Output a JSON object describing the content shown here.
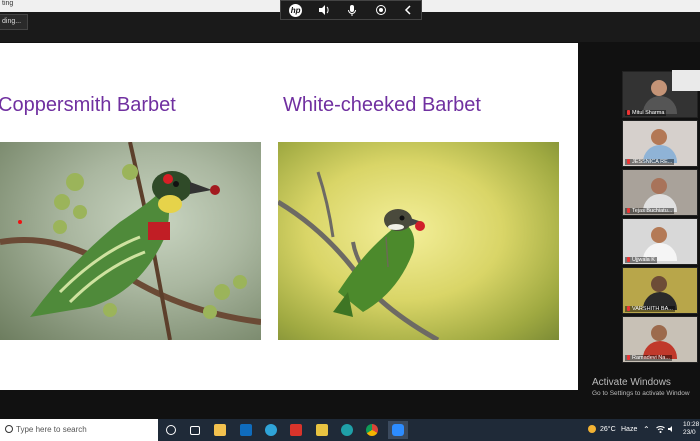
{
  "window": {
    "title_fragment": "ting",
    "recording_label": "ding..."
  },
  "slide": {
    "left_title": "Coppersmith Barbet",
    "right_title": "White-cheeked Barbet"
  },
  "participants": [
    {
      "name": "Mitul Sharma"
    },
    {
      "name": "JESSNICA RE..."
    },
    {
      "name": "Tejas Buchiatu..."
    },
    {
      "name": "Ujjwala K"
    },
    {
      "name": "VARSHITH BA..."
    },
    {
      "name": "Ramadevi Na..."
    }
  ],
  "watermark": {
    "line1": "Activate Windows",
    "line2": "Go to Settings to activate Window"
  },
  "taskbar": {
    "search_placeholder": "Type here to search",
    "temperature": "26°C",
    "weather": "Haze",
    "time": "10:28",
    "date": "23/0"
  },
  "colors": {
    "slide_title": "#7030a0",
    "taskbar": "#1f2a38"
  }
}
